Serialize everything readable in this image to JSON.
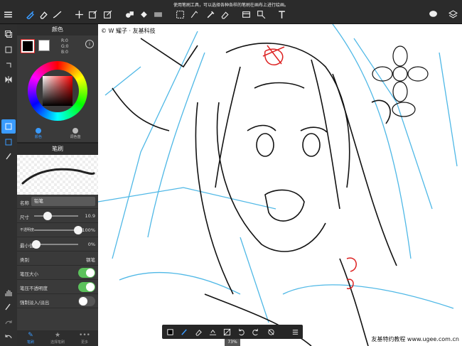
{
  "hint": "使用笔刷工具，可以选择各种各样的笔刷在画布上进行绘画。",
  "canvas": {
    "copyright": "© W 耀子 · 友基科技",
    "watermark": "友基特约教程 www.ugee.com.cn"
  },
  "color_panel": {
    "title": "颜色",
    "rgb": [
      "R:0",
      "G:0",
      "B:0"
    ],
    "modes": [
      "颜色",
      "调色盘"
    ]
  },
  "brush_panel": {
    "title": "笔刷",
    "name_label": "名称",
    "name_value": "铅笔",
    "size_label": "尺寸",
    "size_value": "10.9",
    "opacity_label": "不透明度",
    "opacity_value": "100%",
    "min_label": "最小值",
    "min_value": "0%",
    "category_label": "类别",
    "category_value": "钢笔",
    "pressure_size_label": "笔压大小",
    "pressure_opacity_label": "笔压不透明度",
    "fade_label": "强制淡入/淡出"
  },
  "panel_tabs": [
    "笔刷",
    "选择笔刷",
    "更多"
  ],
  "zoom": "73%",
  "sliders": {
    "size": 0.3,
    "opacity": 1.0,
    "min": 0.05
  },
  "toggles": {
    "pressure_size": true,
    "pressure_opacity": true,
    "fade": false
  }
}
